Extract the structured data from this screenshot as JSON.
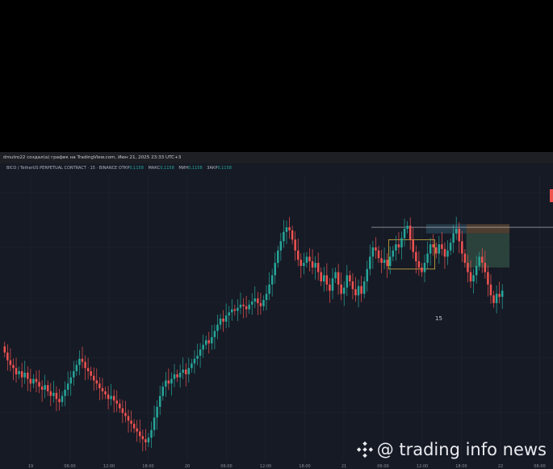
{
  "header": {
    "text": "dmutro22 создал(а) график на TradingView.com, Июн 21, 2025 23:33 UTC+3"
  },
  "symbol": {
    "name": "BICO / TetherUS PERPETUAL CONTRACT · 15 · BINANCE",
    "open_label": "ОТКР",
    "open": "0,1158",
    "high_label": "МАКС",
    "high": "0,1158",
    "low_label": "МИН",
    "low": "0,1158",
    "close_label": "ЗАКР",
    "close": "0,1158"
  },
  "annotation": "15",
  "watermark": "@ trading info news",
  "colors": {
    "background": "#161a25",
    "up": "#26a69a",
    "down": "#ef5350",
    "grid": "#222632",
    "rect_yellow": "#d2b040",
    "target_zone": "#2e4a3f",
    "entry_zone": "#27404f",
    "stop_zone": "#574434"
  },
  "chart_data": {
    "type": "candlestick",
    "interval": "15",
    "x_ticks": [
      "19",
      "06:00",
      "12:00",
      "18:00",
      "20",
      "06:00",
      "12:00",
      "18:00",
      "21",
      "06:00",
      "12:00",
      "18:00",
      "22",
      "06:00"
    ],
    "close": [
      0.106,
      0.1055,
      0.1052,
      0.105,
      0.1046,
      0.1048,
      0.1044,
      0.1047,
      0.1043,
      0.104,
      0.1043,
      0.1041,
      0.1038,
      0.1036,
      0.1039,
      0.1035,
      0.1032,
      0.1034,
      0.103,
      0.1028,
      0.1032,
      0.1036,
      0.104,
      0.1044,
      0.1048,
      0.1052,
      0.1056,
      0.1054,
      0.105,
      0.1048,
      0.1045,
      0.1042,
      0.104,
      0.1037,
      0.1035,
      0.1033,
      0.103,
      0.1032,
      0.1029,
      0.1027,
      0.1024,
      0.1021,
      0.1019,
      0.1016,
      0.1014,
      0.1011,
      0.1009,
      0.1006,
      0.1004,
      0.1002,
      0.1005,
      0.101,
      0.1018,
      0.1025,
      0.1032,
      0.1038,
      0.1042,
      0.104,
      0.1043,
      0.1046,
      0.1044,
      0.1047,
      0.1049,
      0.1046,
      0.105,
      0.1053,
      0.1056,
      0.1058,
      0.1062,
      0.1065,
      0.1068,
      0.1066,
      0.107,
      0.1074,
      0.1078,
      0.1082,
      0.108,
      0.1084,
      0.1086,
      0.1088,
      0.1087,
      0.1089,
      0.1091,
      0.109,
      0.1088,
      0.1091,
      0.1093,
      0.1095,
      0.1092,
      0.109,
      0.1094,
      0.1098,
      0.1104,
      0.111,
      0.1118,
      0.1126,
      0.1132,
      0.1138,
      0.1141,
      0.1139,
      0.1133,
      0.1126,
      0.112,
      0.1116,
      0.1118,
      0.1122,
      0.1119,
      0.1115,
      0.1118,
      0.1112,
      0.1106,
      0.111,
      0.1104,
      0.11,
      0.1108,
      0.1112,
      0.1104,
      0.1098,
      0.1102,
      0.111,
      0.1106,
      0.1101,
      0.1097,
      0.1103,
      0.1098,
      0.1106,
      0.1114,
      0.1122,
      0.1128,
      0.1126,
      0.1121,
      0.1118,
      0.112,
      0.1116,
      0.1122,
      0.1126,
      0.113,
      0.1128,
      0.1134,
      0.114,
      0.1142,
      0.1133,
      0.1125,
      0.1119,
      0.1115,
      0.1112,
      0.1118,
      0.1124,
      0.113,
      0.1128,
      0.1124,
      0.113,
      0.1127,
      0.1122,
      0.1126,
      0.1131,
      0.1137,
      0.114,
      0.1132,
      0.1124,
      0.1118,
      0.1112,
      0.1106,
      0.111,
      0.1116,
      0.1122,
      0.1118,
      0.1112,
      0.1104,
      0.1097,
      0.1092,
      0.1098,
      0.1096,
      0.11
    ],
    "ylim": [
      0.099,
      0.1175
    ],
    "resistance_line": 0.1141,
    "boxes": [
      {
        "name": "consolidation",
        "x_start": 134,
        "x_end": 150,
        "y_low": 0.1114,
        "y_high": 0.1133
      },
      {
        "name": "entry",
        "x_start": 147,
        "x_end": 161,
        "y_low": 0.1137,
        "y_high": 0.1143
      },
      {
        "name": "stop",
        "x_start": 161,
        "x_end": 176,
        "y_low": 0.1137,
        "y_high": 0.1143
      },
      {
        "name": "target",
        "x_start": 161,
        "x_end": 176,
        "y_low": 0.1115,
        "y_high": 0.1137
      }
    ]
  }
}
